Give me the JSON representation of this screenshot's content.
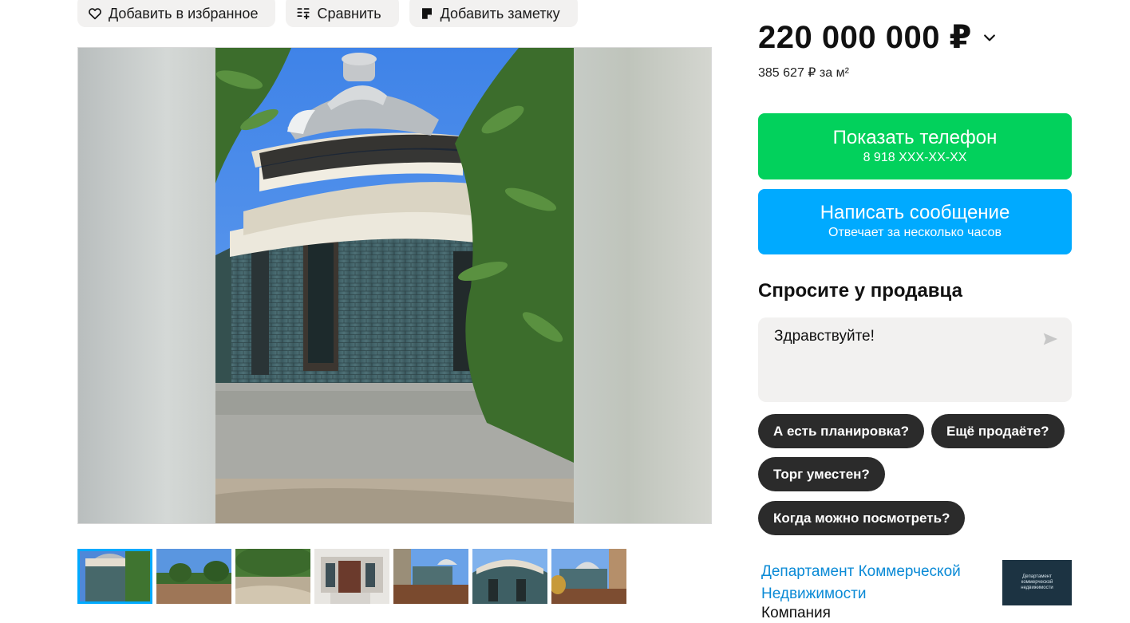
{
  "actions": {
    "favorite_label": "Добавить в избранное",
    "compare_label": "Сравнить",
    "note_label": "Добавить заметку"
  },
  "price": {
    "amount": "220 000 000 ₽",
    "per_m2": "385 627 ₽ за м²"
  },
  "contact": {
    "phone_title": "Показать телефон",
    "phone_masked": "8 918 XXX-XX-XX",
    "message_title": "Написать сообщение",
    "message_sub": "Отвечает за несколько часов"
  },
  "ask": {
    "title": "Спросите у продавца",
    "message_value": "Здравствуйте!",
    "quick_questions": [
      "А есть планировка?",
      "Ещё продаёте?",
      "Торг уместен?",
      "Когда можно посмотреть?"
    ]
  },
  "seller": {
    "name": "Департамент Коммерческой Недвижимости",
    "type": "Компания",
    "logo_text": "Департамент коммерческой недвижимости"
  },
  "gallery": {
    "thumbnail_count": 7,
    "active_index": 0
  },
  "colors": {
    "green": "#02d15c",
    "blue": "#00aaff",
    "chip": "#2b2b2b",
    "link": "#0a8ad6"
  },
  "icons": [
    "heart-icon",
    "compare-icon",
    "note-icon",
    "chevron-down-icon",
    "send-icon"
  ]
}
